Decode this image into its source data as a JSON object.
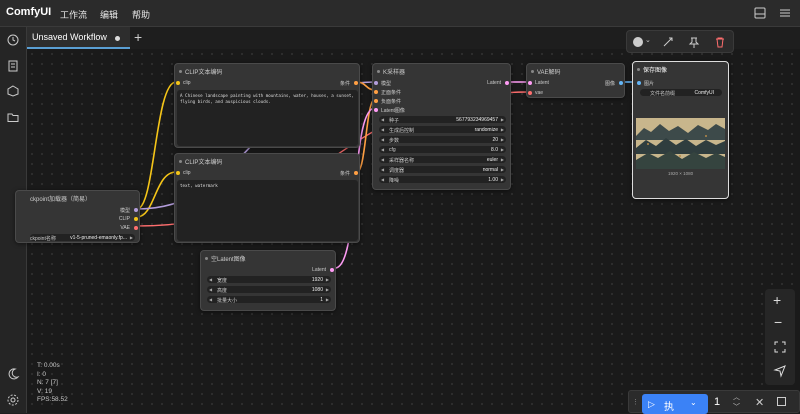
{
  "app": {
    "logo": "ComfyUI",
    "menu": [
      "工作流",
      "编辑",
      "帮助"
    ]
  },
  "tab": {
    "label": "Unsaved Workflow",
    "add": "+"
  },
  "stats": [
    "T: 0.00s",
    "I: 0",
    "N: 7 [7]",
    "V: 19",
    "FPS:58.52"
  ],
  "colors": {
    "clip": "#f5c518",
    "model": "#b39ddb",
    "conditioning": "#ff9f43",
    "latent": "#ff9cf5",
    "vae": "#ff6e6e",
    "image": "#64b5f6"
  },
  "nodes": {
    "checkpoint": {
      "title": "ckpoint加载器（简易）",
      "outputs": [
        "模型",
        "CLIP",
        "VAE"
      ],
      "widget_label": "ckpoint名称",
      "widget_value": "v1-5-pruned-emaonly.fp..."
    },
    "clip_pos": {
      "title": "CLIP文本编码",
      "input": "clip",
      "output": "条件",
      "text": "A Chinese landscape painting with mountains, water, houses, a sunset, flying birds, and auspicious clouds."
    },
    "clip_neg": {
      "title": "CLIP文本编码",
      "input": "clip",
      "output": "条件",
      "text": "text, watermark"
    },
    "ksampler": {
      "title": "K采样器",
      "inputs": [
        "模型",
        "正面条件",
        "负面条件",
        "Latent图像"
      ],
      "output": "Latent",
      "widgets": [
        {
          "label": "种子",
          "value": "567793234969457"
        },
        {
          "label": "生成后控制",
          "value": "randomize"
        },
        {
          "label": "步数",
          "value": "20"
        },
        {
          "label": "cfg",
          "value": "8.0"
        },
        {
          "label": "采样器名称",
          "value": "euler"
        },
        {
          "label": "调度器",
          "value": "normal"
        },
        {
          "label": "降噪",
          "value": "1.00"
        }
      ]
    },
    "vae_decode": {
      "title": "VAE解码",
      "inputs": [
        "Latent",
        "vae"
      ],
      "output": "图像"
    },
    "save_image": {
      "title": "保存图像",
      "input": "图片",
      "widget_label": "文件名前缀",
      "widget_value": "ComfyUI",
      "caption": "1920 × 1080"
    },
    "empty_latent": {
      "title": "空Latent图像",
      "output": "Latent",
      "widgets": [
        {
          "label": "宽度",
          "value": "1920"
        },
        {
          "label": "高度",
          "value": "1080"
        },
        {
          "label": "批量大小",
          "value": "1"
        }
      ]
    }
  },
  "run": {
    "label": "执",
    "count": "1"
  }
}
